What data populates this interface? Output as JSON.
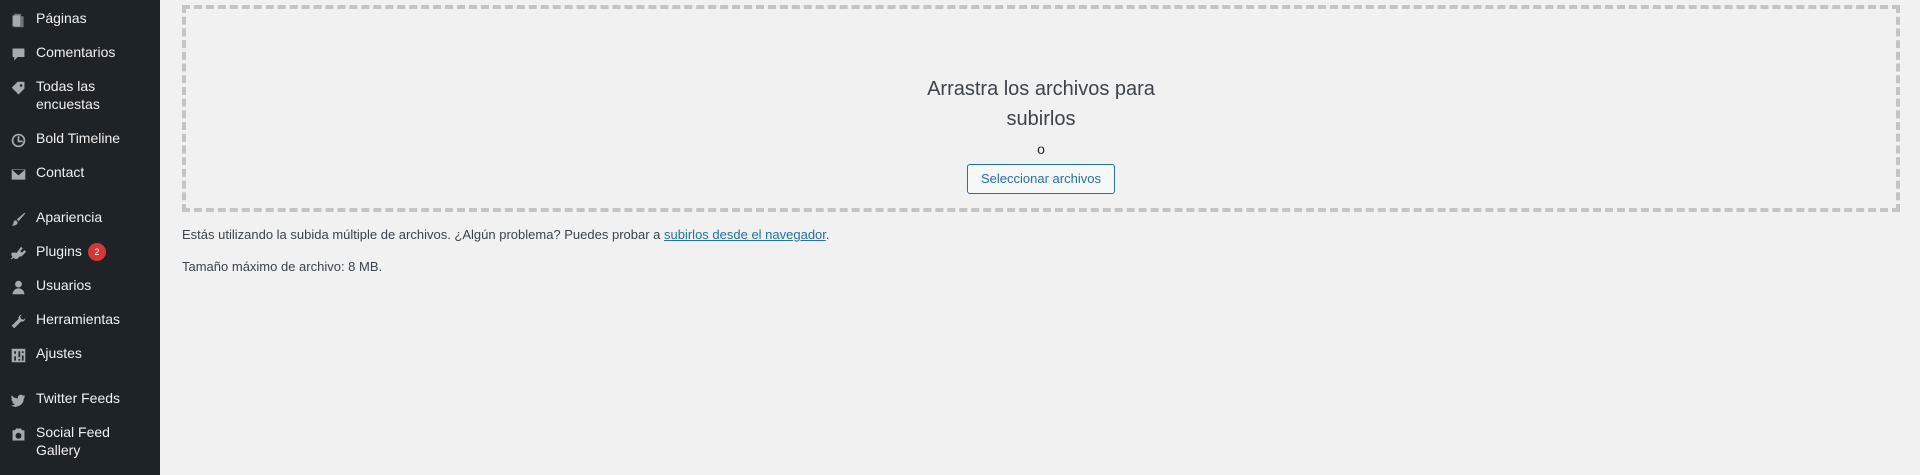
{
  "sidebar": {
    "items": [
      {
        "label": "Páginas",
        "icon": "pages-icon"
      },
      {
        "label": "Comentarios",
        "icon": "comments-icon"
      },
      {
        "label": "Todas las encuestas",
        "icon": "tag-icon"
      },
      {
        "label": "Bold Timeline",
        "icon": "clock-icon"
      },
      {
        "label": "Contact",
        "icon": "envelope-icon"
      },
      {
        "label": "Apariencia",
        "icon": "paintbrush-icon"
      },
      {
        "label": "Plugins",
        "icon": "plugin-icon",
        "badge": "2"
      },
      {
        "label": "Usuarios",
        "icon": "user-icon"
      },
      {
        "label": "Herramientas",
        "icon": "wrench-icon"
      },
      {
        "label": "Ajustes",
        "icon": "settings-icon"
      },
      {
        "label": "Twitter Feeds",
        "icon": "twitter-icon"
      },
      {
        "label": "Social Feed Gallery",
        "icon": "camera-icon"
      }
    ]
  },
  "upload": {
    "drop_title_line1": "Arrastra los archivos para",
    "drop_title_line2": "subirlos",
    "or_text": "o",
    "select_button": "Seleccionar archivos",
    "multi_upload_text": "Estás utilizando la subida múltiple de archivos. ¿Algún problema? Puedes probar a ",
    "browser_link": "subirlos desde el navegador",
    "multi_upload_suffix": ".",
    "max_size_text": "Tamaño máximo de archivo: 8 MB."
  },
  "colors": {
    "sidebar_bg": "#1d2327",
    "page_bg": "#f1f1f1",
    "accent": "#2271b1",
    "badge": "#d63638"
  }
}
